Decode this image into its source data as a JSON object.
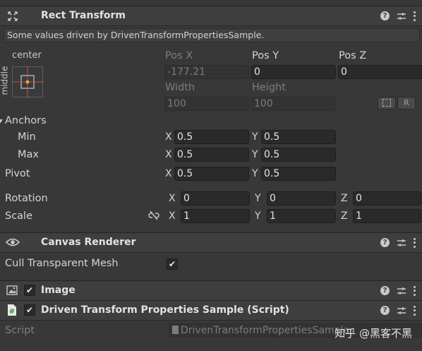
{
  "rect_transform": {
    "title": "Rect Transform",
    "notice": "Some values driven by DrivenTransformPropertiesSample.",
    "anchor_preset_label": "center",
    "anchor_preset_side_label": "middle",
    "pos_x_label": "Pos X",
    "pos_y_label": "Pos Y",
    "pos_z_label": "Pos Z",
    "pos_x": "-177.21",
    "pos_y": "0",
    "pos_z": "0",
    "width_label": "Width",
    "height_label": "Height",
    "width": "100",
    "height": "100",
    "raw_edit_label": "R",
    "anchors_label": "Anchors",
    "min_label": "Min",
    "max_label": "Max",
    "min_x": "0.5",
    "min_y": "0.5",
    "max_x": "0.5",
    "max_y": "0.5",
    "pivot_label": "Pivot",
    "pivot_x": "0.5",
    "pivot_y": "0.5",
    "rotation_label": "Rotation",
    "rot_x": "0",
    "rot_y": "0",
    "rot_z": "0",
    "scale_label": "Scale",
    "scale_x": "1",
    "scale_y": "1",
    "scale_z": "1",
    "axis_x": "X",
    "axis_y": "Y",
    "axis_z": "Z"
  },
  "canvas_renderer": {
    "title": "Canvas Renderer",
    "cull_label": "Cull Transparent Mesh",
    "cull_checked": true
  },
  "image": {
    "title": "Image",
    "enabled": true
  },
  "driven_script": {
    "title": "Driven Transform Properties Sample (Script)",
    "enabled": true,
    "script_label": "Script",
    "script_value": "DrivenTransformPropertiesSample"
  },
  "watermark": "知乎 @黑客不黑",
  "icons": {
    "rect_transform": "rect-transform-icon",
    "canvas_renderer": "eye-icon",
    "image": "image-icon",
    "script": "script-hash-icon",
    "help": "help-icon",
    "presets": "presets-icon",
    "menu": "kebab-menu-icon",
    "link": "unlink-icon",
    "blueprint": "blueprint-mode-icon"
  },
  "colors": {
    "background": "#383838",
    "header": "#3e3e3e",
    "field": "#2a2a2a",
    "anchor_dot": "#e8a33a",
    "anchor_lines": "#d44b4b"
  }
}
